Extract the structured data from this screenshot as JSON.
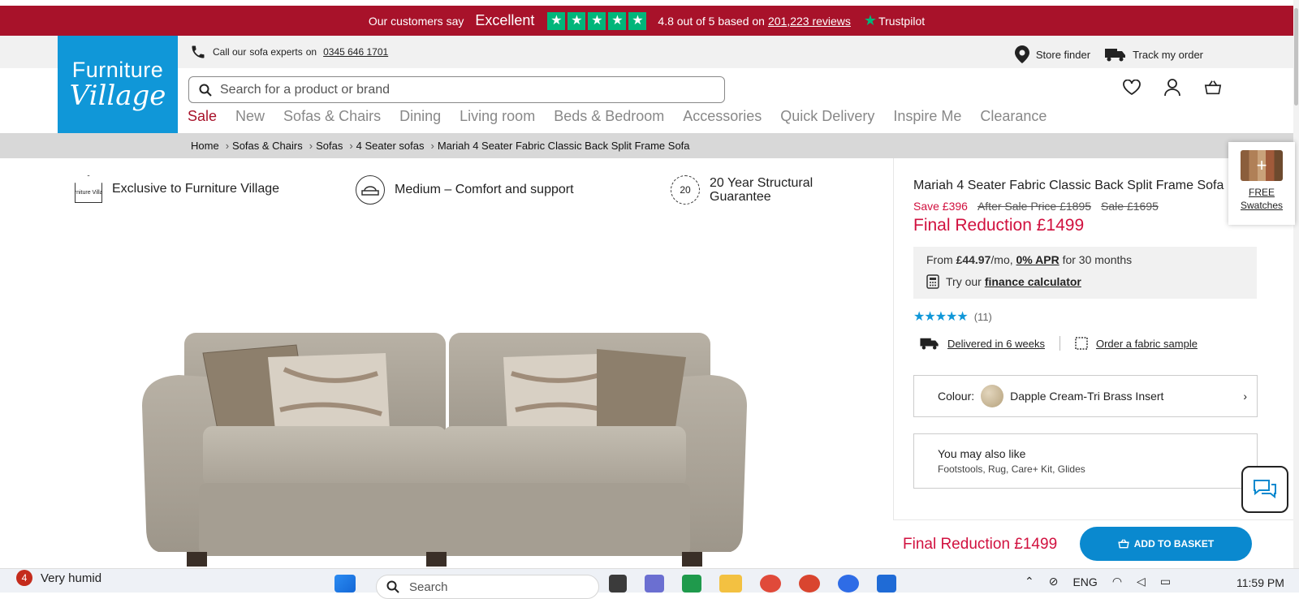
{
  "trustpilot": {
    "customers_say": "Our customers say",
    "rating_word": "Excellent",
    "rating_text": "4.8 out of 5 based on",
    "reviews_link": "201,223 reviews",
    "brand": "Trustpilot",
    "stars": 5,
    "color": "#00b67a"
  },
  "brand": {
    "line1": "Furniture",
    "line2": "Village",
    "color": "#1097d8"
  },
  "utility": {
    "call_prefix": "Call our",
    "call_bold": "sofa experts",
    "call_on": "on",
    "phone": "0345 646 1701",
    "store_finder": "Store finder",
    "track_order": "Track my order"
  },
  "search": {
    "placeholder": "Search for a product or brand"
  },
  "nav": [
    "Sale",
    "New",
    "Sofas & Chairs",
    "Dining",
    "Living room",
    "Beds & Bedroom",
    "Accessories",
    "Quick Delivery",
    "Inspire Me",
    "Clearance"
  ],
  "breadcrumb": [
    "Home",
    "Sofas & Chairs",
    "Sofas",
    "4 Seater sofas",
    "Mariah 4 Seater Fabric Classic Back Split Frame Sofa"
  ],
  "features": {
    "exclusive": "Exclusive to Furniture Village",
    "exclusive_icon_text": "Furniture Village",
    "comfort": "Medium – Comfort and support",
    "guarantee_line1": "20 Year Structural",
    "guarantee_line2": "Guarantee",
    "guarantee_badge": "20"
  },
  "product": {
    "title": "Mariah 4 Seater Fabric Classic Back Split Frame Sofa",
    "save": "Save £396",
    "after_sale": "After Sale Price £1895",
    "sale": "Sale £1695",
    "final": "Final Reduction £1499",
    "finance_from": "From",
    "finance_amount": "£44.97",
    "finance_per": "/mo,",
    "finance_apr": "0% APR",
    "finance_term": "for 30 months",
    "finance_try": "Try our",
    "finance_calc": "finance calculator",
    "rating_count": "(11)",
    "rating_value": 5,
    "delivery": "Delivered in 6 weeks",
    "fabric_sample": "Order a fabric sample",
    "colour_label": "Colour:",
    "colour_value": "Dapple Cream-Tri Brass Insert",
    "ymal_title": "You may also like",
    "ymal_items": "Footstools, Rug, Care+ Kit, Glides"
  },
  "sticky": {
    "price": "Final Reduction £1499",
    "basket": "ADD TO BASKET"
  },
  "swatches": {
    "label1": "FREE",
    "label2": "Swatches"
  },
  "taskbar": {
    "badge": "4",
    "weather": "Very humid",
    "search_placeholder": "Search",
    "lang": "ENG",
    "time": "11:59 PM"
  },
  "colors": {
    "accent_red": "#a8122a",
    "price_red": "#d1113f",
    "basket_blue": "#0a89cf"
  }
}
